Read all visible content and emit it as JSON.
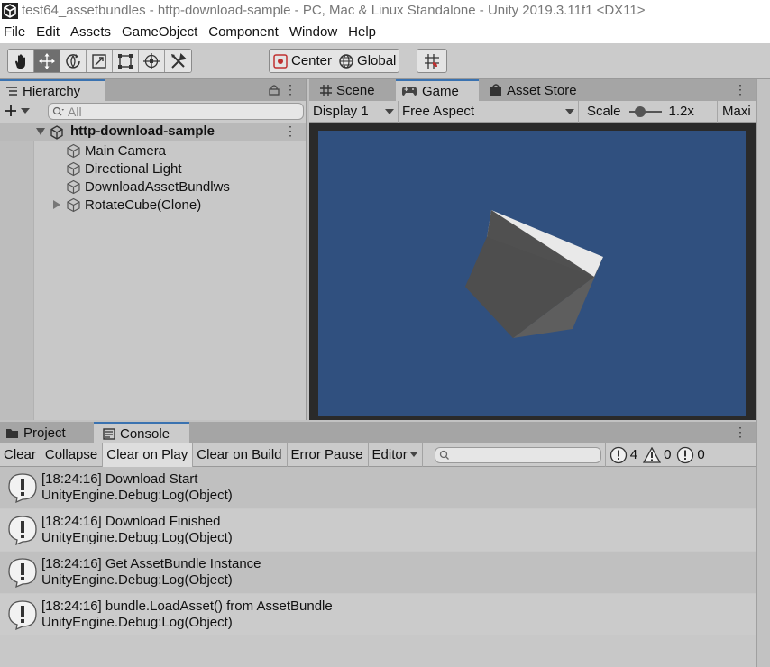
{
  "window": {
    "title": "test64_assetbundles - http-download-sample - PC, Mac & Linux Standalone - Unity 2019.3.11f1 <DX11>"
  },
  "menu": [
    "File",
    "Edit",
    "Assets",
    "GameObject",
    "Component",
    "Window",
    "Help"
  ],
  "toolbar": {
    "tools": [
      "hand-tool-icon",
      "move-tool-icon",
      "rotate-tool-icon",
      "scale-tool-icon",
      "rect-tool-icon",
      "transform-tool-icon",
      "custom-tool-icon"
    ],
    "active_tool": "move-tool-icon",
    "pivot_mode": "Center",
    "pivot_space": "Global"
  },
  "hierarchy": {
    "tab": "Hierarchy",
    "search_placeholder": "All",
    "scene_name": "http-download-sample",
    "items": [
      {
        "label": "Main Camera"
      },
      {
        "label": "Directional Light"
      },
      {
        "label": "DownloadAssetBundlws"
      },
      {
        "label": "RotateCube(Clone)"
      }
    ]
  },
  "game_panel": {
    "tabs": [
      {
        "label": "Scene",
        "icon": "grid-icon"
      },
      {
        "label": "Game",
        "icon": "gamepad-icon"
      },
      {
        "label": "Asset Store",
        "icon": "shopping-bag-icon"
      }
    ],
    "active_tab": "Game",
    "display": "Display 1",
    "aspect": "Free Aspect",
    "scale_label": "Scale",
    "scale_value": "1.2x",
    "scale_level": 0.25,
    "maximize_label": "Maxi",
    "viewport_color": "#30507f"
  },
  "console_panel": {
    "tabs": [
      {
        "label": "Project",
        "icon": "folder-icon"
      },
      {
        "label": "Console",
        "icon": "console-icon"
      }
    ],
    "active_tab": "Console",
    "buttons": {
      "clear": "Clear",
      "collapse": "Collapse",
      "clear_on_play": "Clear on Play",
      "clear_on_build": "Clear on Build",
      "error_pause": "Error Pause",
      "editor": "Editor"
    },
    "counts": {
      "info": "4",
      "warning": "0",
      "error": "0"
    },
    "logs": [
      {
        "line1": "[18:24:16] Download Start",
        "line2": "UnityEngine.Debug:Log(Object)"
      },
      {
        "line1": "[18:24:16] Download Finished",
        "line2": "UnityEngine.Debug:Log(Object)"
      },
      {
        "line1": "[18:24:16] Get AssetBundle Instance",
        "line2": "UnityEngine.Debug:Log(Object)"
      },
      {
        "line1": "[18:24:16] bundle.LoadAsset() from AssetBundle",
        "line2": "UnityEngine.Debug:Log(Object)"
      }
    ]
  }
}
